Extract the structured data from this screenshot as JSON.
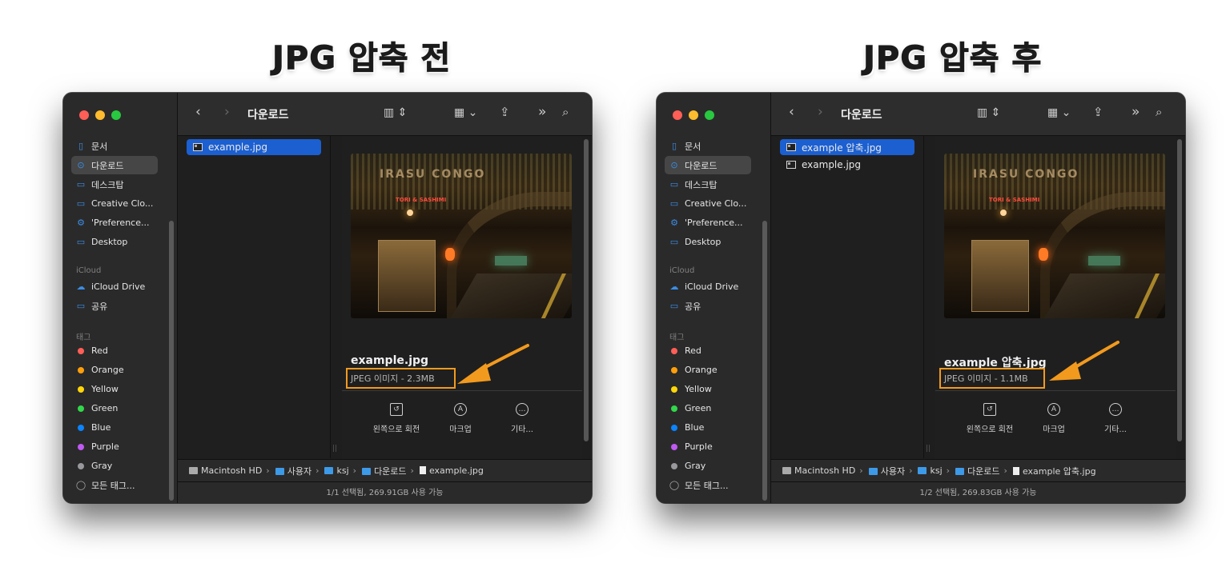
{
  "headings": {
    "left": "JPG 압축 전",
    "right": "JPG 압축 후"
  },
  "colors": {
    "accent": "#f29a1e",
    "selection": "#1b5fd1",
    "folder_icon": "#3a8ee6"
  },
  "sidebar": {
    "favorites": [
      "문서",
      "다운로드",
      "데스크탑",
      "Creative Clo...",
      "'Preference...",
      "Desktop"
    ],
    "icloud_header": "iCloud",
    "icloud_items": [
      "iCloud Drive",
      "공유"
    ],
    "tags_header": "태그",
    "tags": [
      {
        "label": "Red",
        "color": "#ff5f57"
      },
      {
        "label": "Orange",
        "color": "#ff9f0a"
      },
      {
        "label": "Yellow",
        "color": "#ffd60a"
      },
      {
        "label": "Green",
        "color": "#32d74b"
      },
      {
        "label": "Blue",
        "color": "#0a84ff"
      },
      {
        "label": "Purple",
        "color": "#bf5af2"
      },
      {
        "label": "Gray",
        "color": "#98989d"
      }
    ],
    "all_tags": "모든 태그..."
  },
  "toolbar": {
    "title": "다운로드",
    "back": "‹",
    "forward": "›",
    "more": "»"
  },
  "actions": {
    "rotate": "왼쪽으로 회전",
    "markup": "마크업",
    "more": "기타..."
  },
  "path_common": [
    "Macintosh HD",
    "사용자",
    "ksj",
    "다운로드"
  ],
  "left": {
    "files": [
      "example.jpg"
    ],
    "preview_name": "example.jpg",
    "preview_meta": "JPEG 이미지 - 2.3MB",
    "path_file": "example.jpg",
    "status": "1/1 선택됨, 269.91GB 사용 가능"
  },
  "right": {
    "files": [
      "example 압축.jpg",
      "example.jpg"
    ],
    "preview_name": "example 압축.jpg",
    "preview_meta": "JPEG 이미지 - 1.1MB",
    "path_file": "example 압축.jpg",
    "status": "1/2 선택됨, 269.83GB 사용 가능"
  },
  "photo_text": {
    "sign": "IRASU CONGO",
    "neon": "TORI & SASHIMI"
  }
}
